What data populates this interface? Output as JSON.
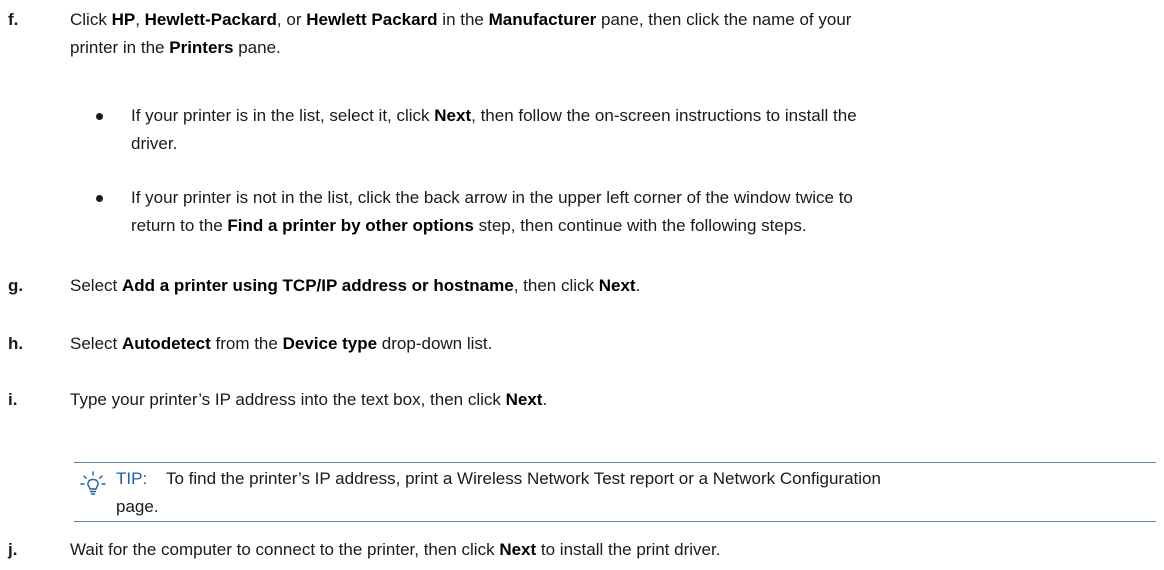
{
  "steps": {
    "f": {
      "letter": "f.",
      "parts": [
        "Click ",
        "HP",
        ", ",
        "Hewlett-Packard",
        ", or ",
        "Hewlett Packard",
        " in the ",
        "Manufacturer",
        " pane, then click the name of your"
      ],
      "line2_parts": [
        "printer in the ",
        "Printers",
        " pane."
      ]
    },
    "f_bullet1": {
      "line1_parts": [
        "If your printer is in the list, select it, click ",
        "Next",
        ", then follow the on-screen instructions to install the"
      ],
      "line2": "driver."
    },
    "f_bullet2": {
      "line1": "If your printer is not in the list, click the back arrow in the upper left corner of the window twice to",
      "line2_parts": [
        "return to the ",
        "Find a printer by other options",
        " step, then continue with the following steps."
      ]
    },
    "g": {
      "letter": "g.",
      "parts": [
        "Select ",
        "Add a printer using TCP/IP address or hostname",
        ", then click ",
        "Next",
        "."
      ]
    },
    "h": {
      "letter": "h.",
      "parts": [
        "Select ",
        "Autodetect",
        " from the ",
        "Device type",
        " drop-down list."
      ]
    },
    "i": {
      "letter": "i.",
      "parts": [
        "Type your printer’s IP address into the text box, then click ",
        "Next",
        "."
      ]
    },
    "tip": {
      "label": "TIP:",
      "line1": "To find the printer’s IP address, print a Wireless Network Test report or a Network Configuration",
      "line2": "page."
    },
    "j": {
      "letter": "j.",
      "parts": [
        "Wait for the computer to connect to the printer, then click ",
        "Next",
        " to install the print driver."
      ]
    }
  },
  "colors": {
    "text": "#1a1a1a",
    "tip_label": "#1f5fa8",
    "tip_rule": "#5b7fb0",
    "tip_icon": "#1f5fa8"
  },
  "icons": {
    "tip": "lightbulb-icon"
  }
}
